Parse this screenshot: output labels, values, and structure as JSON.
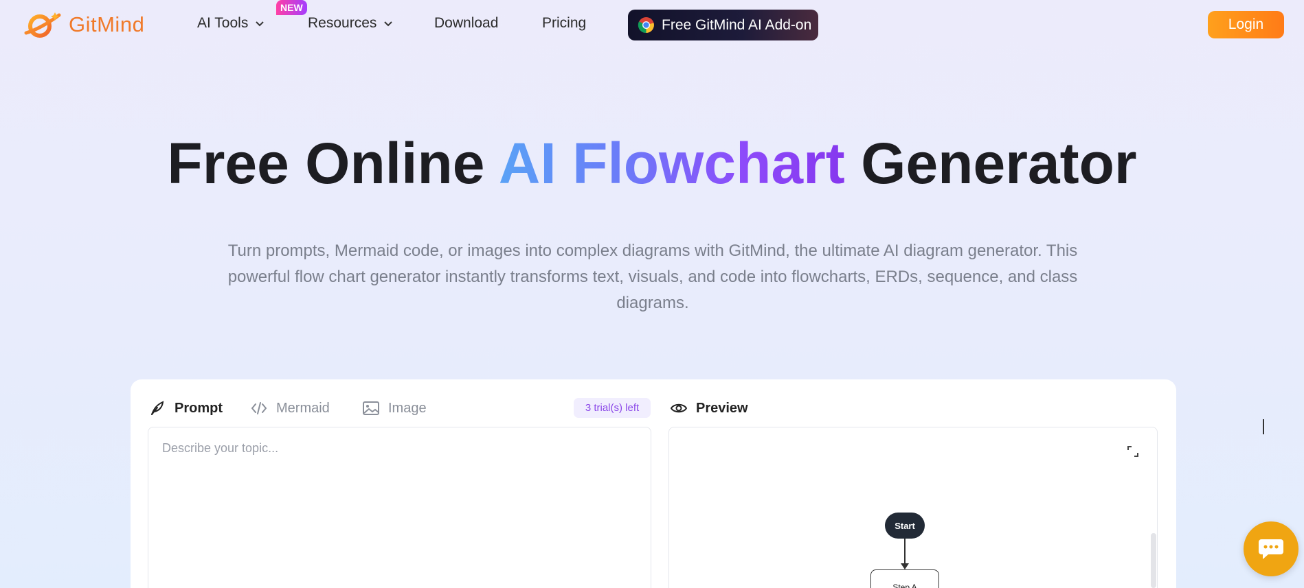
{
  "header": {
    "logo_text": "GitMind",
    "nav": {
      "ai_tools": "AI Tools",
      "new_badge": "NEW",
      "resources": "Resources",
      "download": "Download",
      "pricing": "Pricing"
    },
    "addon_button": "Free GitMind AI Add-on",
    "login_button": "Login"
  },
  "hero": {
    "title_part1": "Free Online ",
    "title_highlight": "AI Flowchart",
    "title_part2": " Generator",
    "subtitle": "Turn prompts, Mermaid code, or images into complex diagrams with GitMind, the ultimate AI diagram generator. This powerful flow chart generator instantly transforms text, visuals, and code into flowcharts, ERDs, sequence, and class diagrams."
  },
  "tool": {
    "tabs": [
      {
        "label": "Prompt",
        "icon": "feather-icon",
        "active": true
      },
      {
        "label": "Mermaid",
        "icon": "code-icon",
        "active": false
      },
      {
        "label": "Image",
        "icon": "image-icon",
        "active": false
      }
    ],
    "trial_badge": "3 trial(s) left",
    "editor_placeholder": "Describe your topic...",
    "preview_label": "Preview",
    "preview_nodes": {
      "start": "Start",
      "step_a": "Step A"
    }
  },
  "colors": {
    "brand_orange": "#f07a2a",
    "login_gradient_start": "#ffa01c",
    "gradient_blue": "#5aa2f6",
    "gradient_purple": "#8637ee",
    "chat_button": "#f0a512"
  }
}
